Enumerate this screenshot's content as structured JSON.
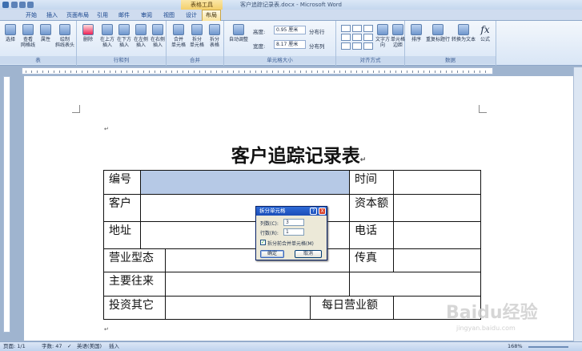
{
  "window": {
    "title": "客户追踪记录表.docx - Microsoft Word",
    "context_tab_group": "表格工具"
  },
  "tabs": [
    "开始",
    "插入",
    "页面布局",
    "引用",
    "邮件",
    "审阅",
    "视图",
    "设计",
    "布局"
  ],
  "active_tab": "布局",
  "ribbon": {
    "groups": {
      "table": {
        "label": "表",
        "buttons": [
          "选择",
          "查看\n网格线",
          "属性",
          "绘制\n斜线表头"
        ]
      },
      "rows_cols": {
        "label": "行和列",
        "buttons": [
          "删除",
          "在上方\n插入",
          "在下方\n插入",
          "在左侧\n插入",
          "在右侧\n插入"
        ]
      },
      "merge": {
        "label": "合并",
        "buttons": [
          "合并\n单元格",
          "拆分\n单元格",
          "拆分\n表格"
        ]
      },
      "cell_size": {
        "label": "单元格大小",
        "autofit": "自动调整",
        "height_label": "高度:",
        "height_value": "0.95 厘米",
        "width_label": "宽度:",
        "width_value": "8.17 厘米",
        "distribute_rows": "分布行",
        "distribute_cols": "分布列"
      },
      "alignment": {
        "label": "对齐方式",
        "buttons": [
          "文字方向",
          "单元格\n边距"
        ]
      },
      "data": {
        "label": "数据",
        "buttons": [
          "排序",
          "重复标题行",
          "转换为文本",
          "公式"
        ]
      }
    }
  },
  "document": {
    "title": "客户追踪记录表",
    "table": {
      "row1": [
        "编号",
        "",
        "时间",
        ""
      ],
      "row2": [
        "客户",
        "",
        "资本额",
        ""
      ],
      "row3": [
        "地址",
        "",
        "电话",
        ""
      ],
      "row4": [
        "营业型态",
        "",
        "传真",
        ""
      ],
      "row5": [
        "主要往来",
        "",
        ""
      ],
      "row6": [
        "投资其它",
        "",
        "每日营业额",
        ""
      ]
    },
    "paragraph_mark": "↵"
  },
  "dialog": {
    "title": "拆分单元格",
    "cols_label": "列数(C):",
    "cols_value": "3",
    "rows_label": "行数(R):",
    "rows_value": "1",
    "merge_checkbox_label": "拆分前合并单元格(M)",
    "merge_checked": true,
    "ok_label": "确定",
    "cancel_label": "取消",
    "help_glyph": "?",
    "close_glyph": "X"
  },
  "status_bar": {
    "page": "页面: 1/1",
    "words": "字数: 47",
    "language": "英语(美国)",
    "mode": "插入",
    "zoom": "168%"
  },
  "watermark": {
    "text": "Baidu经验",
    "sub": "jingyan.baidu.com"
  }
}
